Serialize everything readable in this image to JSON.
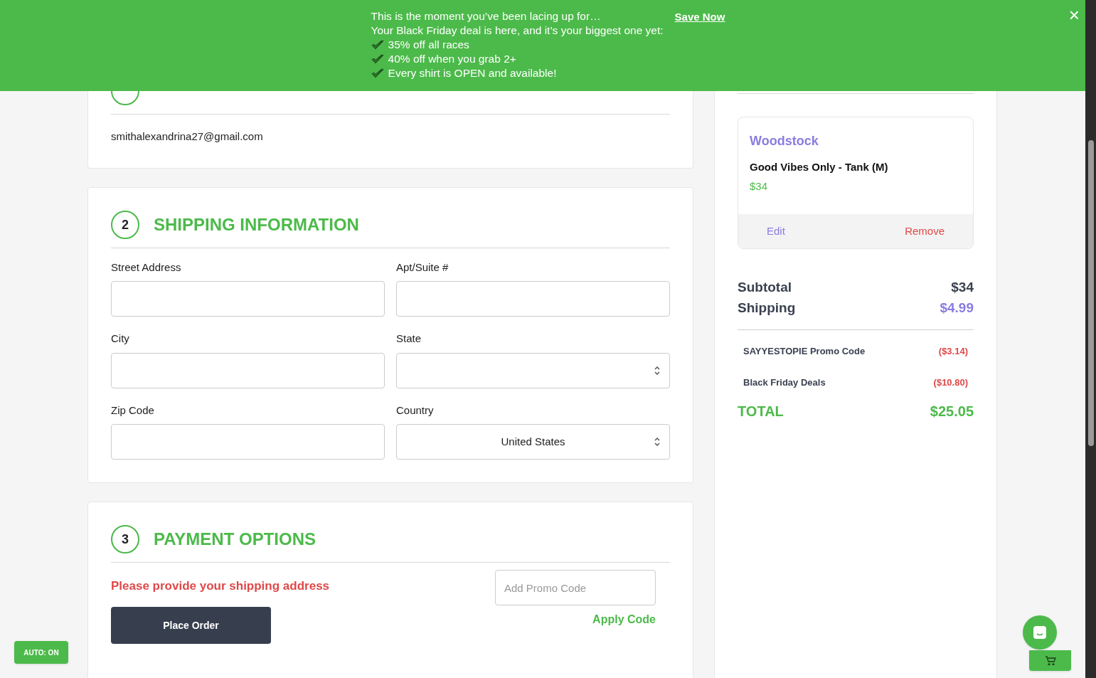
{
  "banner": {
    "lines": [
      "This is the moment you’ve been lacing up for…",
      "Your Black Friday deal is here, and it’s your biggest one yet:"
    ],
    "perks": [
      "35% off all races",
      "40% off when you grab 2+",
      "Every shirt is OPEN and available!"
    ],
    "link": "Save Now",
    "close": "×"
  },
  "account": {
    "email": "smithalexandrina27@gmail.com"
  },
  "shipping": {
    "step": "2",
    "title": "SHIPPING INFORMATION",
    "fields": [
      {
        "label": "Street Address",
        "kind": "text"
      },
      {
        "label": "Apt/Suite #",
        "kind": "text"
      },
      {
        "label": "City",
        "kind": "text"
      },
      {
        "label": "State",
        "kind": "select"
      },
      {
        "label": "Zip Code",
        "kind": "text"
      },
      {
        "label": "Country",
        "kind": "select",
        "value": "United States"
      }
    ]
  },
  "payment": {
    "step": "3",
    "title": "PAYMENT OPTIONS",
    "error": "Please provide your shipping address",
    "button": "Place Order",
    "promo": {
      "placeholder": "Add Promo Code"
    },
    "apply": "Apply Code"
  },
  "cart": {
    "item": {
      "event": "Woodstock",
      "name": "Good Vibes Only - Tank (M)",
      "price": "$34",
      "edit": "Edit",
      "remove": "Remove"
    },
    "subtotal": {
      "label": "Subtotal",
      "value": "$34"
    },
    "shipping": {
      "label": "Shipping",
      "value": "$4.99"
    },
    "discounts": [
      {
        "label": "SAYYESTOPIE Promo Code",
        "value": "($3.14)"
      },
      {
        "label": "Black Friday Deals",
        "value": "($10.80)"
      }
    ],
    "total": {
      "label": "TOTAL",
      "value": "$25.05"
    }
  },
  "auto_button": "AUTO: ON"
}
